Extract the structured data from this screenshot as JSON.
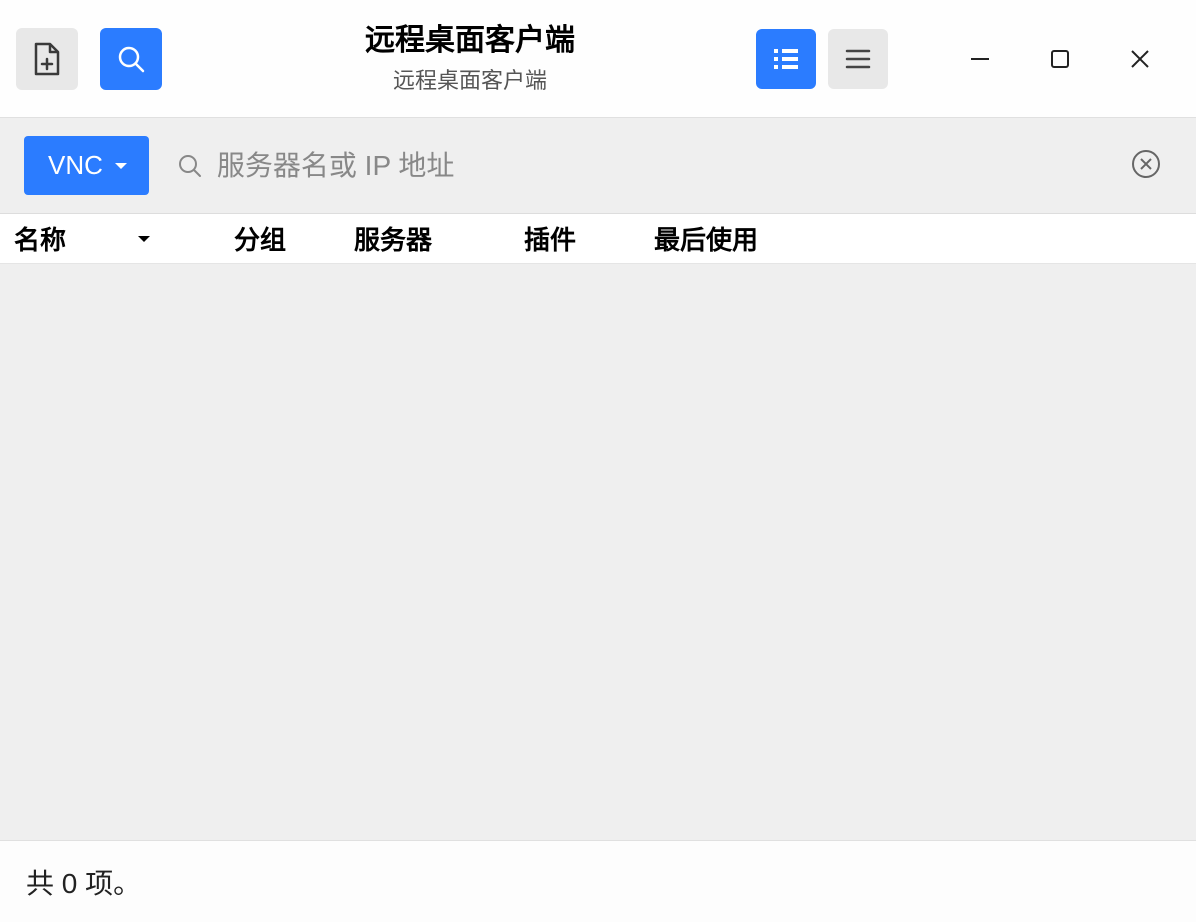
{
  "header": {
    "title": "远程桌面客户端",
    "subtitle": "远程桌面客户端"
  },
  "search": {
    "protocol_label": "VNC",
    "placeholder": "服务器名或 IP 地址"
  },
  "columns": {
    "name": "名称",
    "group": "分组",
    "server": "服务器",
    "plugin": "插件",
    "last_used": "最后使用"
  },
  "status": {
    "text": "共 0 项。"
  },
  "colors": {
    "accent": "#2b7cff",
    "bg_gray": "#efefef",
    "btn_gray": "#e8e8e8"
  }
}
